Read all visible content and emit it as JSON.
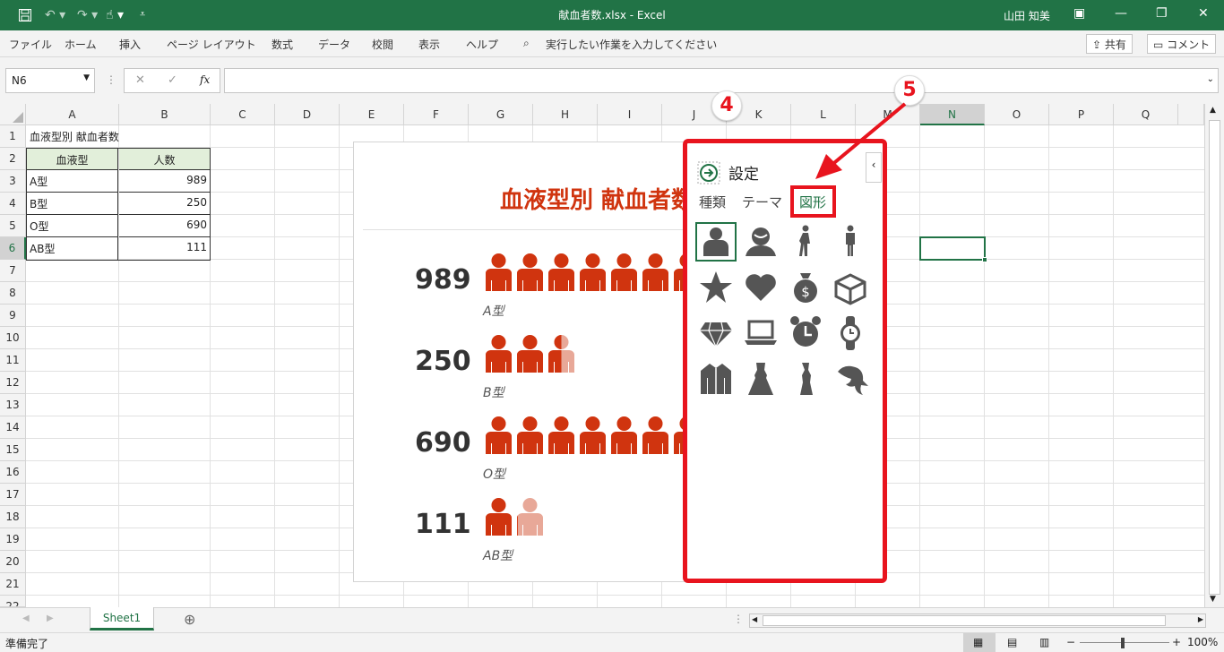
{
  "window": {
    "title": "献血者数.xlsx  -  Excel",
    "user": "山田 知美"
  },
  "ribbon": {
    "tabs": [
      "ファイル",
      "ホーム",
      "挿入",
      "ページ レイアウト",
      "数式",
      "データ",
      "校閲",
      "表示",
      "ヘルプ"
    ],
    "search_placeholder": "実行したい作業を入力してください",
    "share": "共有",
    "comment": "コメント"
  },
  "formula_bar": {
    "name_box": "N6",
    "fx": "fx",
    "cancel": "✕",
    "enter": "✓",
    "value": ""
  },
  "columns": [
    "A",
    "B",
    "C",
    "D",
    "E",
    "F",
    "G",
    "H",
    "I",
    "J",
    "K",
    "L",
    "M",
    "N",
    "O",
    "P",
    "Q"
  ],
  "rows": [
    "1",
    "2",
    "3",
    "4",
    "5",
    "6",
    "7",
    "8",
    "9",
    "10",
    "11",
    "12",
    "13",
    "14",
    "15",
    "16",
    "17",
    "18",
    "19",
    "20",
    "21",
    "22"
  ],
  "selected_cell": "N6",
  "sheet_cells": {
    "a1": "血液型別 献血者数",
    "header": [
      "血液型",
      "人数"
    ],
    "data": [
      {
        "type": "A型",
        "count": "989"
      },
      {
        "type": "B型",
        "count": "250"
      },
      {
        "type": "O型",
        "count": "690"
      },
      {
        "type": "AB型",
        "count": "111"
      }
    ]
  },
  "chart_data": {
    "type": "pictograph",
    "title": "血液型別 献血者数",
    "categories": [
      "A型",
      "B型",
      "O型",
      "AB型"
    ],
    "values": [
      989,
      250,
      690,
      111
    ],
    "color": "#d0340f",
    "light_color": "#e8a898"
  },
  "settings_panel": {
    "title": "設定",
    "tabs": [
      "種類",
      "テーマ",
      "図形"
    ],
    "active_tab": "図形",
    "collapse": "‹",
    "shapes": [
      "person-bust-icon",
      "person-avatar-icon",
      "walking-man-icon",
      "standing-man-icon",
      "star-icon",
      "heart-icon",
      "money-bag-icon",
      "box-icon",
      "diamond-icon",
      "laptop-icon",
      "alarm-clock-icon",
      "watch-icon",
      "jacket-icon",
      "dress-icon",
      "slim-dress-icon",
      "dolphin-icon"
    ],
    "selected_shape": "person-bust-icon"
  },
  "annotations": {
    "step4": "4",
    "step5": "5"
  },
  "sheet_tabs": [
    "Sheet1"
  ],
  "status": {
    "ready": "準備完了",
    "zoom": "100%"
  },
  "colors": {
    "excel_green": "#217346",
    "highlight_red": "#e8141e"
  }
}
